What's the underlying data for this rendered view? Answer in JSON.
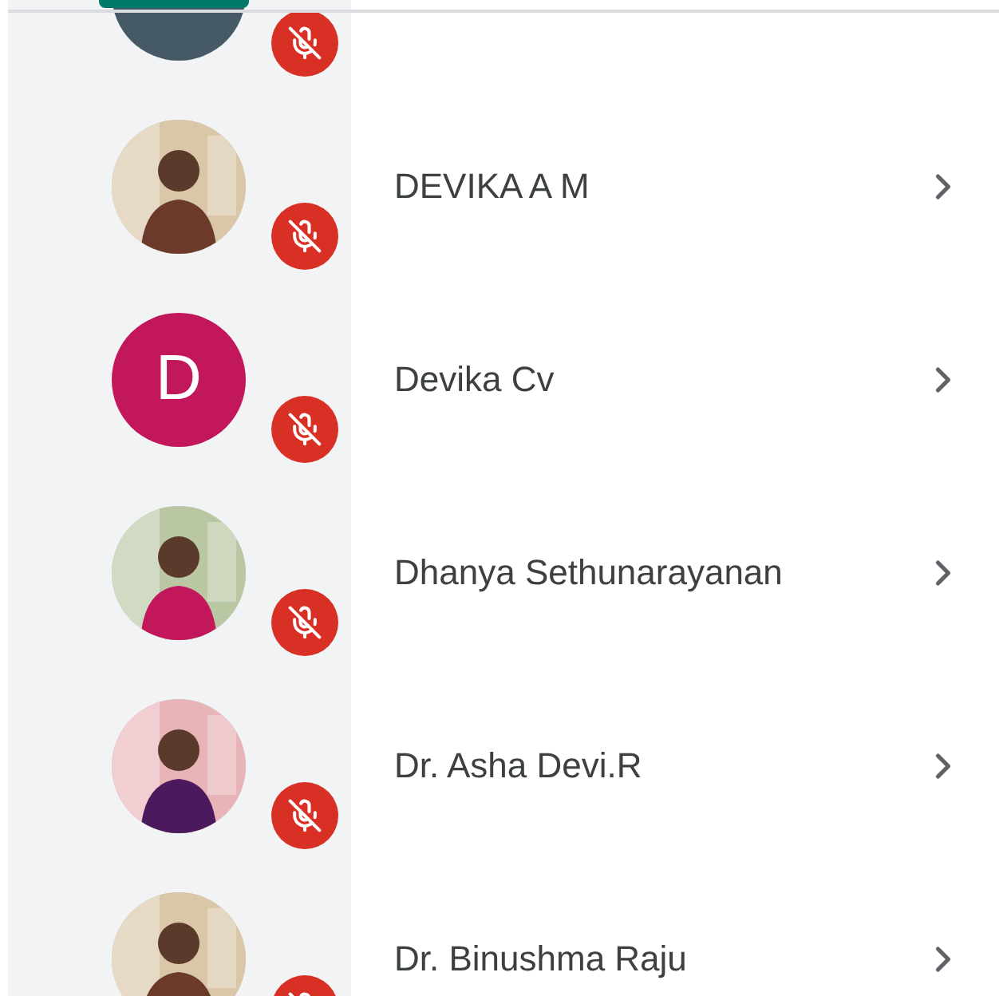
{
  "tabs": [
    {
      "selected": true
    }
  ],
  "participants": [
    {
      "avatar": {
        "kind": "blank",
        "color": "#455a64"
      },
      "muted": true
    },
    {
      "name": "DEVIKA A M",
      "muted": true
    },
    {
      "name": "Devika Cv",
      "avatar": {
        "kind": "initial",
        "letter": "D",
        "color": "#c2185b"
      },
      "muted": true
    },
    {
      "name": "Dhanya Sethunarayanan",
      "muted": true
    },
    {
      "name": "Dr. Asha Devi.R",
      "muted": true
    },
    {
      "name": "Dr. Binushma Raju",
      "muted": true
    }
  ]
}
